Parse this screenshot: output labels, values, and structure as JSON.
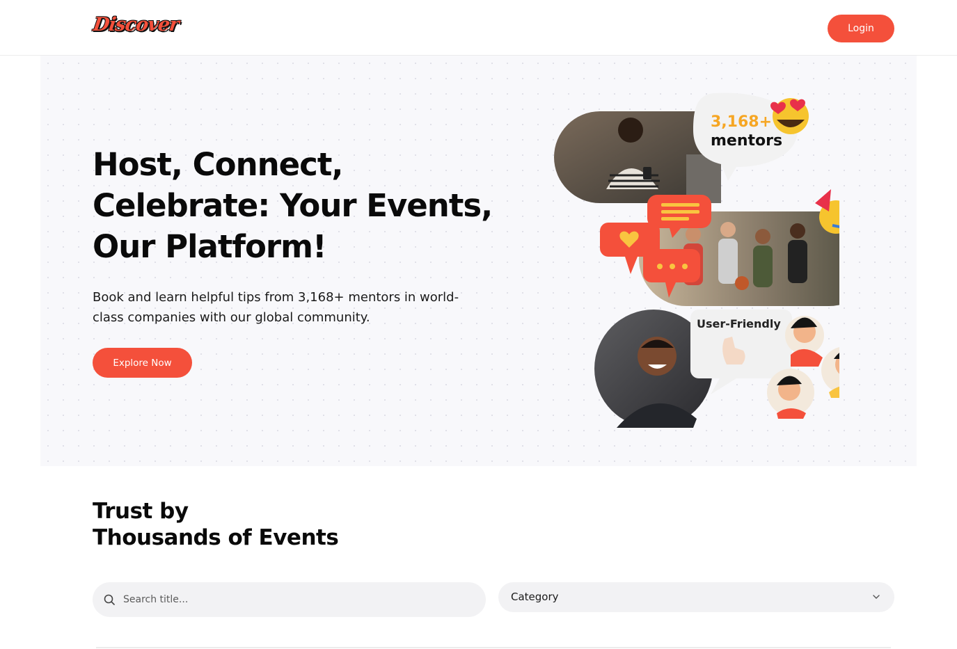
{
  "header": {
    "logo_text": "Discover",
    "login_label": "Login"
  },
  "hero": {
    "title": "Host, Connect, Celebrate: Your Events, Our Platform!",
    "subtitle": "Book and learn helpful tips from 3,168+ mentors in world-class companies with our global community.",
    "cta_label": "Explore Now",
    "collage": {
      "mentor_count": "3,168+",
      "mentor_label": "mentors",
      "badge_label": "User-Friendly"
    }
  },
  "trust": {
    "title_line1": "Trust by",
    "title_line2": "Thousands of Events"
  },
  "filters": {
    "search_placeholder": "Search title...",
    "category_label": "Category"
  },
  "colors": {
    "accent": "#F4503B",
    "hero_bg": "#F8F8FB",
    "input_bg": "#F2F2F4"
  }
}
